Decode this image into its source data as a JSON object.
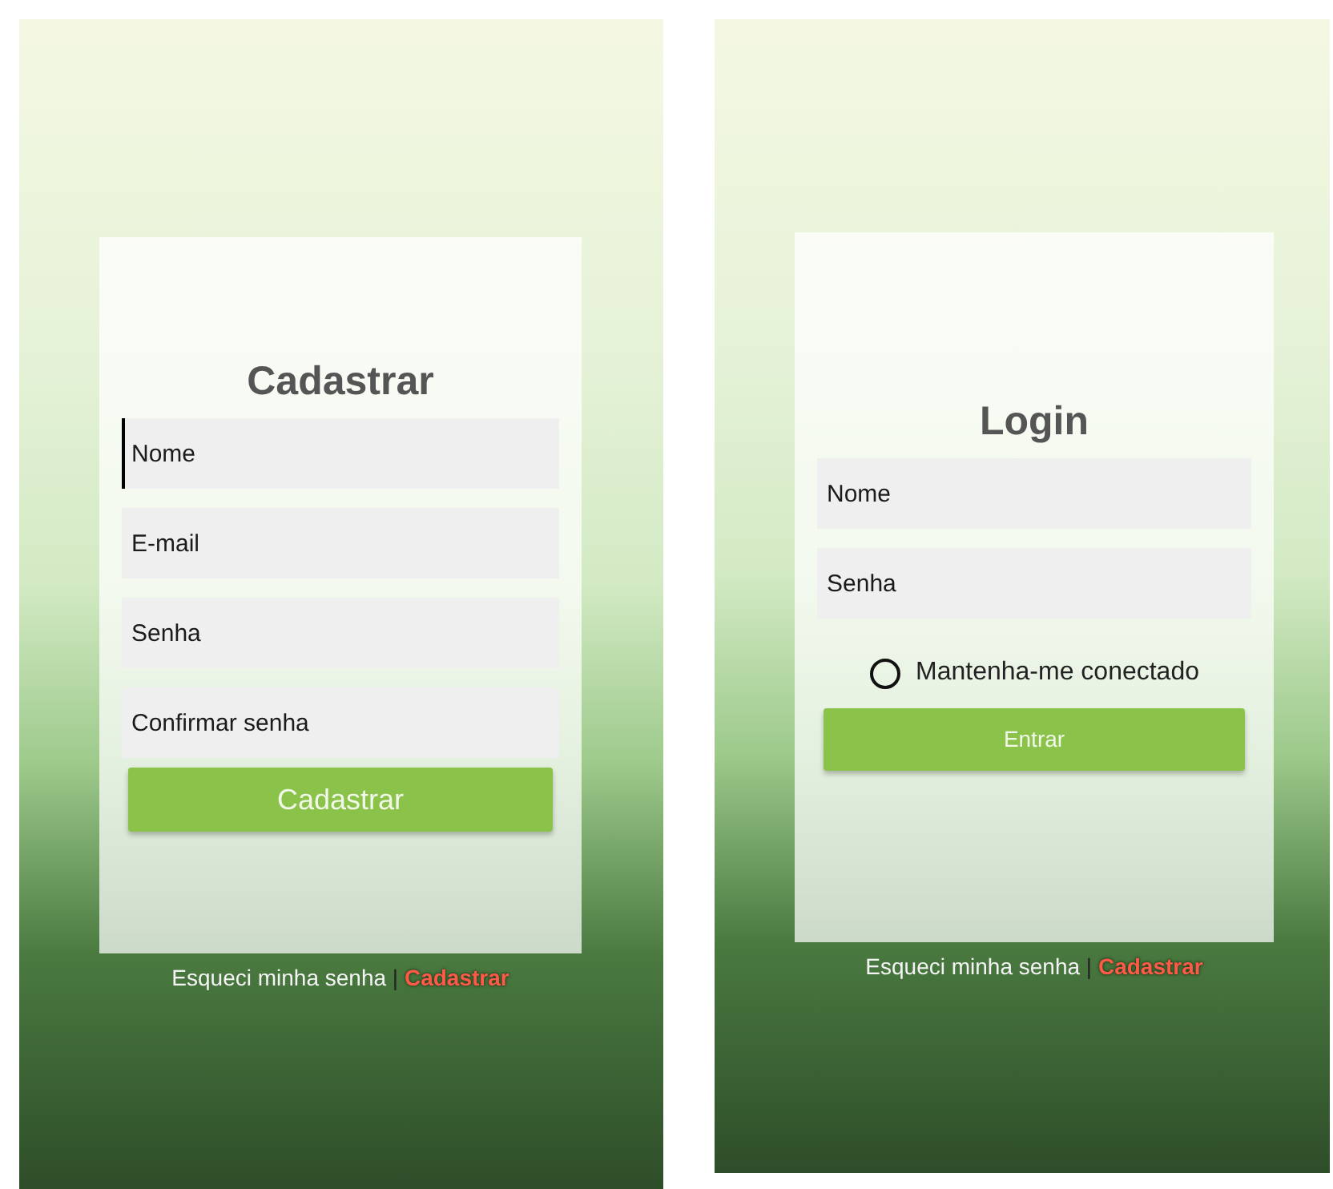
{
  "screens": [
    {
      "title": "Cadastrar",
      "fields": [
        {
          "placeholder": "Nome",
          "focused": true
        },
        {
          "placeholder": "E-mail",
          "focused": false
        },
        {
          "placeholder": "Senha",
          "focused": false
        },
        {
          "placeholder": "Confirmar senha",
          "focused": false
        }
      ],
      "button": "Cadastrar",
      "footer": {
        "forgot": "Esqueci minha senha",
        "separator": "|",
        "register": "Cadastrar"
      }
    },
    {
      "title": "Login",
      "fields": [
        {
          "placeholder": "Nome",
          "focused": false
        },
        {
          "placeholder": "Senha",
          "focused": false
        }
      ],
      "remember": {
        "label": "Mantenha-me conectado",
        "checked": false
      },
      "button": "Entrar",
      "footer": {
        "forgot": "Esqueci minha senha",
        "separator": "|",
        "register": "Cadastrar"
      }
    }
  ]
}
